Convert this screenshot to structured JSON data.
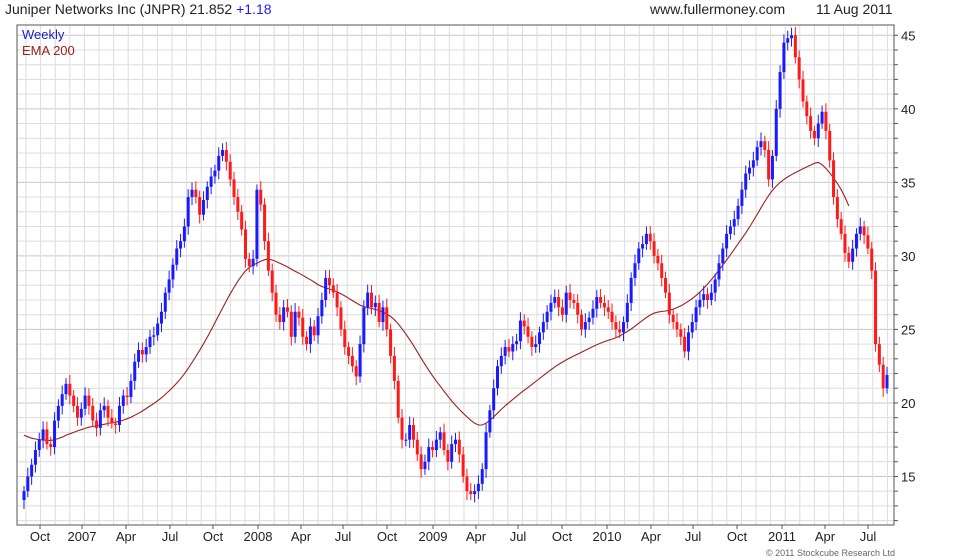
{
  "header": {
    "ticker": "Juniper Networks Inc (JNPR) 21.852",
    "change": "+1.18",
    "site": "www.fullermoney.com",
    "date": "11 Aug 2011"
  },
  "legend": {
    "weekly": "Weekly",
    "ema": "EMA 200"
  },
  "credit": "© 2011 Stockcube Research Ltd",
  "colors": {
    "up": "#1a1aff",
    "down": "#ff1a1a",
    "ema": "#9b2020",
    "grid": "#dcdcdc"
  },
  "chart_data": {
    "type": "line",
    "x_tick_labels": [
      "Oct",
      "2007",
      "Apr",
      "Jul",
      "Oct",
      "2008",
      "Apr",
      "Jul",
      "Oct",
      "2009",
      "Apr",
      "Jul",
      "Oct",
      "2010",
      "Apr",
      "Jul",
      "Oct",
      "2011",
      "Apr",
      "Jul"
    ],
    "y_ticks": [
      15,
      20,
      25,
      30,
      35,
      40,
      45
    ],
    "ylim": [
      11.7,
      45.7
    ],
    "grid": true,
    "series": [
      {
        "name": "Weekly",
        "style": "candlestick-like weekly bars (blue up, red down)",
        "values": [
          14.0,
          15.0,
          15.8,
          16.8,
          17.5,
          18.2,
          17.2,
          17.0,
          18.8,
          19.8,
          20.6,
          21.3,
          20.5,
          19.8,
          19.0,
          19.6,
          20.5,
          19.8,
          18.8,
          18.3,
          19.5,
          19.8,
          19.0,
          18.6,
          18.5,
          19.8,
          20.5,
          20.4,
          21.5,
          22.8,
          23.6,
          23.3,
          23.8,
          24.5,
          24.6,
          25.4,
          26.2,
          27.5,
          28.4,
          29.4,
          30.5,
          31.0,
          32.0,
          34.0,
          34.5,
          34.0,
          32.8,
          33.8,
          34.7,
          35.4,
          35.8,
          36.8,
          37.2,
          36.4,
          35.2,
          34.0,
          33.0,
          31.8,
          29.8,
          29.3,
          29.8,
          34.5,
          33.5,
          31.0,
          29.0,
          27.5,
          26.0,
          25.5,
          26.5,
          26.2,
          24.5,
          26.2,
          25.8,
          24.5,
          24.0,
          25.2,
          24.6,
          25.9,
          27.0,
          28.5,
          28.0,
          27.5,
          26.5,
          25.0,
          23.8,
          23.2,
          22.5,
          21.8,
          24.0,
          26.5,
          27.5,
          26.5,
          26.8,
          25.5,
          26.5,
          25.0,
          23.2,
          21.5,
          19.0,
          17.5,
          17.5,
          18.5,
          17.5,
          16.5,
          15.5,
          16.0,
          17.0,
          16.8,
          17.5,
          18.0,
          16.8,
          16.0,
          17.2,
          17.5,
          16.5,
          15.0,
          14.0,
          13.8,
          14.0,
          14.5,
          15.5,
          18.0,
          19.5,
          21.0,
          22.5,
          23.2,
          23.8,
          23.5,
          24.0,
          24.2,
          25.6,
          25.2,
          24.5,
          23.8,
          24.0,
          24.8,
          25.5,
          26.2,
          26.8,
          27.2,
          26.5,
          26.0,
          27.5,
          27.0,
          26.8,
          26.0,
          25.0,
          25.5,
          25.8,
          26.4,
          27.2,
          26.8,
          26.5,
          26.2,
          25.5,
          25.0,
          24.8,
          25.5,
          26.8,
          28.5,
          29.5,
          30.5,
          30.8,
          31.5,
          31.0,
          30.0,
          29.5,
          28.5,
          27.5,
          26.0,
          25.5,
          25.0,
          24.5,
          23.5,
          24.8,
          25.5,
          26.5,
          27.0,
          27.4,
          27.0,
          27.5,
          28.4,
          29.5,
          30.5,
          31.5,
          32.0,
          32.5,
          33.4,
          34.5,
          35.6,
          36.0,
          36.5,
          37.4,
          37.8,
          37.2,
          35.2,
          36.8,
          40.0,
          42.5,
          44.5,
          44.8,
          45.0,
          43.5,
          42.0,
          40.5,
          39.5,
          38.5,
          38.0,
          39.0,
          39.8,
          38.5,
          36.5,
          34.0,
          32.5,
          31.5,
          30.2,
          29.6,
          30.5,
          31.5,
          32.0,
          31.4,
          30.5,
          29.0,
          24.0,
          22.6,
          21.0,
          21.9
        ]
      },
      {
        "name": "EMA 200",
        "values": [
          17.8,
          17.7,
          17.6,
          17.55,
          17.5,
          17.48,
          17.46,
          17.45,
          17.5,
          17.58,
          17.67,
          17.8,
          17.9,
          18.0,
          18.1,
          18.18,
          18.27,
          18.35,
          18.4,
          18.45,
          18.5,
          18.55,
          18.6,
          18.66,
          18.7,
          18.75,
          18.83,
          18.92,
          19.03,
          19.16,
          19.3,
          19.45,
          19.62,
          19.79,
          19.96,
          20.15,
          20.35,
          20.58,
          20.82,
          21.08,
          21.35,
          21.65,
          21.98,
          22.35,
          22.75,
          23.15,
          23.58,
          24.02,
          24.48,
          24.95,
          25.45,
          25.95,
          26.45,
          26.95,
          27.42,
          27.86,
          28.27,
          28.65,
          28.98,
          29.22,
          29.38,
          29.5,
          29.63,
          29.74,
          29.78,
          29.72,
          29.62,
          29.5,
          29.38,
          29.25,
          29.1,
          28.95,
          28.82,
          28.68,
          28.52,
          28.38,
          28.22,
          28.05,
          27.92,
          27.82,
          27.74,
          27.66,
          27.55,
          27.42,
          27.28,
          27.12,
          26.96,
          26.8,
          26.65,
          26.55,
          26.48,
          26.42,
          26.36,
          26.28,
          26.18,
          26.05,
          25.88,
          25.66,
          25.38,
          25.04,
          24.68,
          24.3,
          23.9,
          23.48,
          23.04,
          22.62,
          22.22,
          21.84,
          21.48,
          21.14,
          20.8,
          20.46,
          20.14,
          19.84,
          19.56,
          19.3,
          19.05,
          18.82,
          18.62,
          18.5,
          18.5,
          18.62,
          18.82,
          19.05,
          19.3,
          19.56,
          19.8,
          20.02,
          20.24,
          20.45,
          20.66,
          20.86,
          21.06,
          21.26,
          21.46,
          21.66,
          21.86,
          22.06,
          22.26,
          22.45,
          22.62,
          22.78,
          22.93,
          23.07,
          23.2,
          23.32,
          23.45,
          23.58,
          23.71,
          23.84,
          23.96,
          24.07,
          24.17,
          24.26,
          24.34,
          24.43,
          24.55,
          24.7,
          24.86,
          25.03,
          25.22,
          25.42,
          25.62,
          25.81,
          25.98,
          26.1,
          26.18,
          26.22,
          26.25,
          26.3,
          26.38,
          26.48,
          26.6,
          26.75,
          26.92,
          27.1,
          27.31,
          27.54,
          27.8,
          28.08,
          28.38,
          28.7,
          29.03,
          29.37,
          29.72,
          30.08,
          30.45,
          30.82,
          31.18,
          31.56,
          31.96,
          32.38,
          32.82,
          33.27,
          33.7,
          34.1,
          34.45,
          34.75,
          35.0,
          35.2,
          35.37,
          35.52,
          35.66,
          35.8,
          35.92,
          36.05,
          36.17,
          36.3,
          36.35,
          36.2,
          35.95,
          35.65,
          35.3,
          34.92,
          34.5,
          34.0,
          33.4
        ]
      }
    ]
  }
}
